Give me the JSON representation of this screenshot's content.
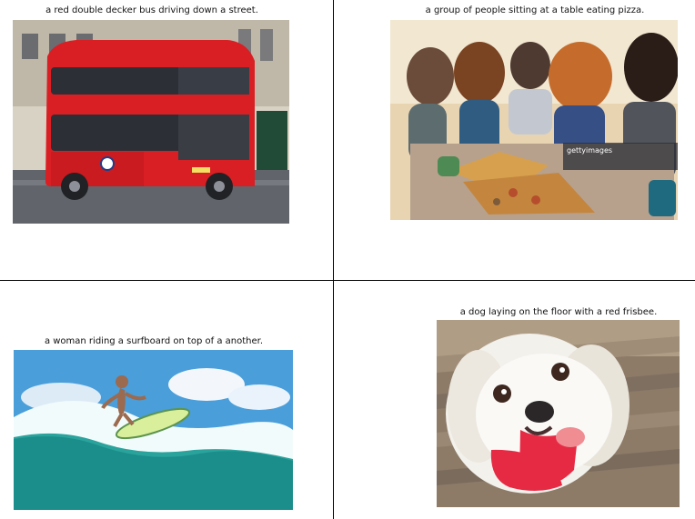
{
  "captions": [
    "a red double decker bus driving down a street.",
    "a group of people sitting at a table eating pizza.",
    "a woman riding a surfboard on top of a another.",
    "a dog laying on the floor with a red frisbee."
  ],
  "images": [
    {
      "subject": "red-double-decker-bus"
    },
    {
      "subject": "people-eating-pizza",
      "watermark": "gettyimages"
    },
    {
      "subject": "woman-surfing"
    },
    {
      "subject": "white-dog-with-red-toy"
    }
  ],
  "colors": {
    "divider": "#000000",
    "bus_red": "#d91f24",
    "sea": "#2aa39d",
    "sky": "#4a9ed9",
    "toy_red": "#e72a44"
  }
}
